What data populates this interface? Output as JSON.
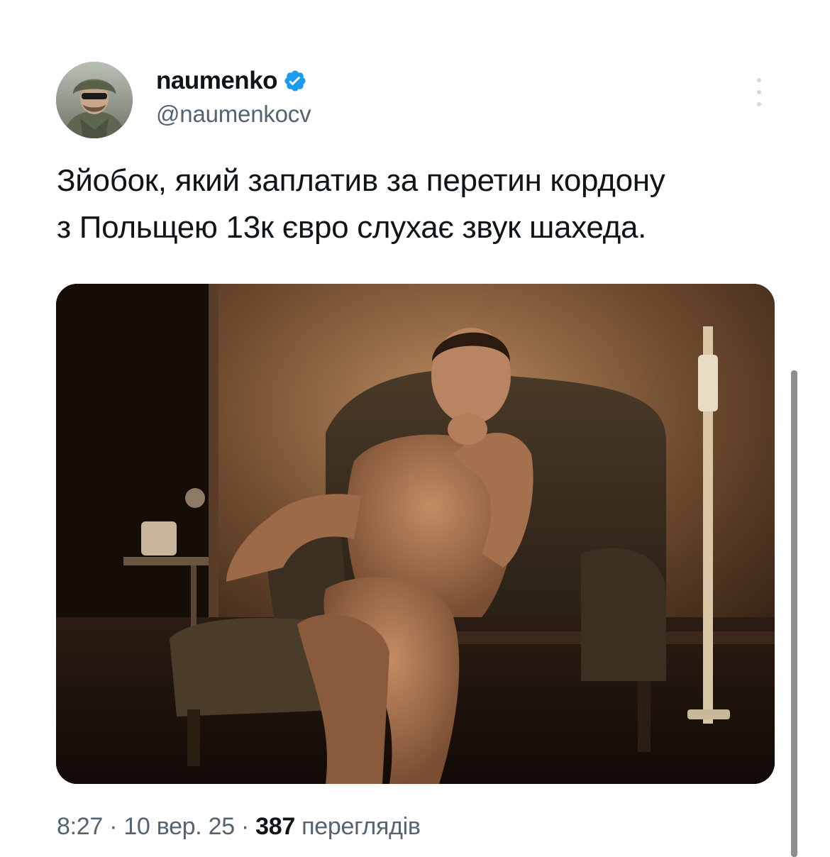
{
  "author": {
    "display_name": "naumenko",
    "handle": "@naumenkocv",
    "verified": true,
    "avatar_icon": "avatar-soldier-helmet"
  },
  "tweet": {
    "text_line1": "Зйобок, який заплатив за перетин кордону",
    "text_line2": "з Польщею 13к євро слухає звук шахеда.",
    "media_description_icon": "photo-man-in-armchair"
  },
  "meta": {
    "time": "8:27",
    "separator": "·",
    "date": "10 вер. 25",
    "views_count": "387",
    "views_label": "переглядів"
  },
  "colors": {
    "text_primary": "#0f1419",
    "text_secondary": "#536471",
    "verified_blue": "#1d9bf0",
    "background": "#ffffff"
  }
}
